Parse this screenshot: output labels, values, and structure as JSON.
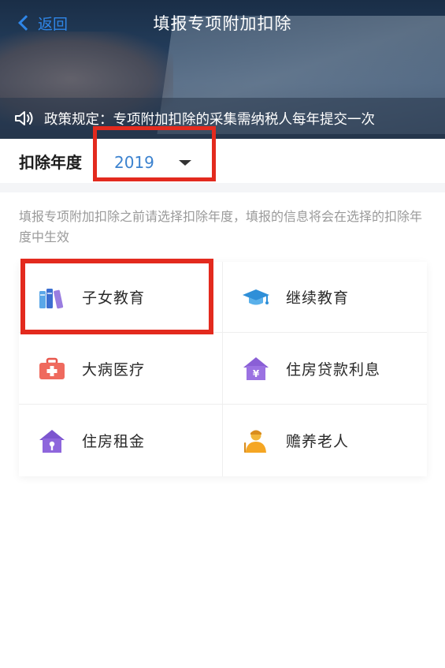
{
  "nav": {
    "back_label": "返回",
    "title": "填报专项附加扣除"
  },
  "notice": {
    "icon": "speaker-icon",
    "text": "政策规定：专项附加扣除的采集需纳税人每年提交一次"
  },
  "year": {
    "label": "扣除年度",
    "selected": "2019"
  },
  "hint": "填报专项附加扣除之前请选择扣除年度，填报的信息将会在选择的扣除年度中生效",
  "items": [
    {
      "label": "子女教育",
      "icon": "books-icon"
    },
    {
      "label": "继续教育",
      "icon": "graduation-cap-icon"
    },
    {
      "label": "大病医疗",
      "icon": "medical-kit-icon"
    },
    {
      "label": "住房贷款利息",
      "icon": "house-loan-icon"
    },
    {
      "label": "住房租金",
      "icon": "house-rent-icon"
    },
    {
      "label": "赡养老人",
      "icon": "elderly-person-icon"
    }
  ],
  "colors": {
    "accent": "#2f86e8",
    "highlight": "#e32a1e",
    "hint": "#9a9a9a"
  }
}
